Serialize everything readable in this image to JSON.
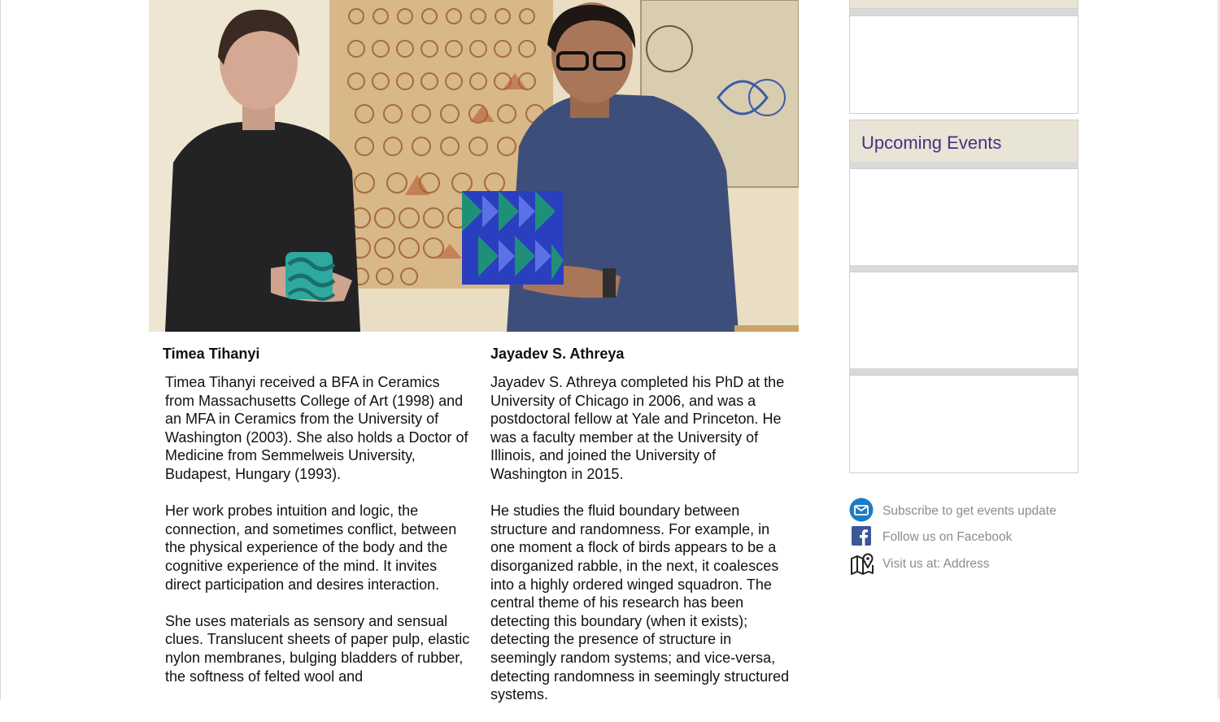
{
  "photo": {
    "alt": "Timea Tihanyi and Jayadev S. Athreya holding geometric sculptures",
    "colors": {
      "wall": "#e7dcc0",
      "poster": "#d9b98a",
      "accent_teal": "#2fa9a0",
      "accent_blue": "#2a3fbf"
    }
  },
  "bios": {
    "left": {
      "name": "Timea Tihanyi",
      "paragraphs": [
        "Timea Tihanyi received a BFA in Ceramics from Massachusetts College of Art (1998) and an MFA in Ceramics from the University of Washington (2003). She also holds a Doctor of Medicine from Semmelweis University, Budapest, Hungary (1993).",
        "Her work probes intuition and logic, the connection, and sometimes conflict, between the physical experience of the body and the cognitive experience of the mind. It invites direct participation and desires interaction.",
        "She uses materials as sensory and sensual clues. Translucent sheets of paper pulp, elastic nylon membranes, bulging bladders of rubber, the softness of felted wool and"
      ]
    },
    "right": {
      "name": "Jayadev S. Athreya",
      "paragraphs": [
        "Jayadev S. Athreya completed his PhD at the University of Chicago in 2006, and was a postdoctoral fellow at Yale and Princeton. He was a faculty member at the University of Illinois, and joined the University of Washington in 2015.",
        "He studies the fluid boundary between structure and randomness. For example, in one moment a flock of birds appears to be a disorganized rabble, in the next, it coalesces into a highly ordered winged squadron. The central theme of his research has been detecting this boundary (when it exists); detecting the presence of structure in seemingly random systems; and vice-versa, detecting randomness in seemingly structured systems."
      ]
    }
  },
  "sidebar": {
    "events_title": "Upcoming Events",
    "title_color": "#4b2e83",
    "links": {
      "subscribe": {
        "label": "Subscribe to get events update",
        "icon": "envelope-icon"
      },
      "facebook": {
        "label": "Follow us on Facebook",
        "icon": "facebook-icon"
      },
      "visit": {
        "label": "Visit us at: Address",
        "icon": "map-pin-icon"
      }
    }
  }
}
